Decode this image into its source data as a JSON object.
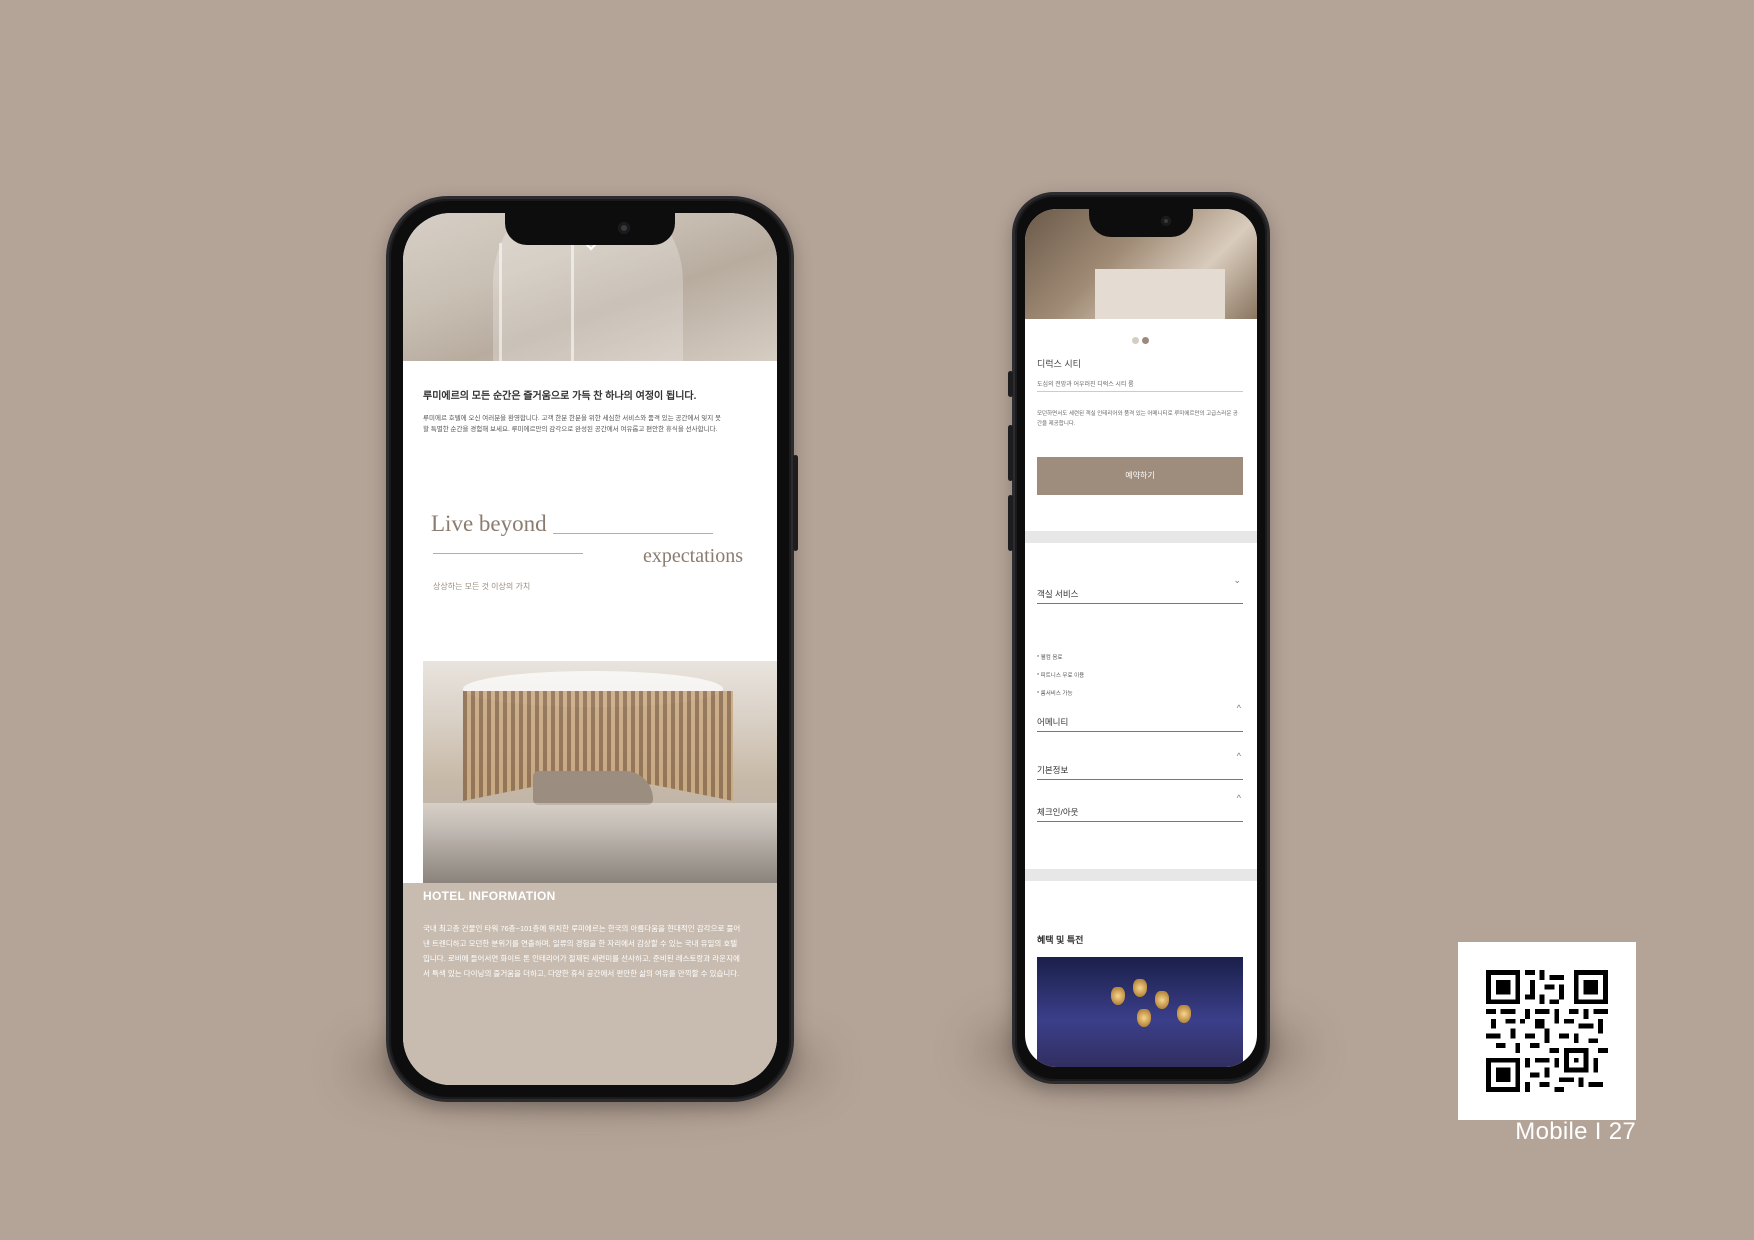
{
  "left_phone": {
    "intro": {
      "title": "루미에르의 모든 순간은 즐거움으로 가득 찬 하나의 여정이 됩니다.",
      "body": "루미에르 호텔에 오신 여러분을 환영합니다. 고객 한분 한분을 위한 세심한 서비스와 품격 있는 공간에서 잊지 못할 특별한 순간을 경험해 보세요. 루미에르만의 감각으로 완성된 공간에서 여유롭고 편안한 휴식을 선사합니다."
    },
    "slogan": {
      "line1": "Live beyond",
      "line2": "expectations",
      "sub": "상상하는 모든 것 이상의 가치"
    },
    "info": {
      "title": "HOTEL INFORMATION",
      "body": "국내 최고층 건물인 타워 76층~101층에 위치한 루미에르는 한국의 아름다움을 현대적인 감각으로 풀어낸 트렌디하고 모던한 분위기를 연출하며, 일류의 경험을 한 자리에서 감상할 수 있는 국내 유일의 호텔입니다. 로비에 들어서면 화이트 톤 인테리어가 절제된 세련미를 선사하고, 준비된 레스토랑과 라운지에서 특색 있는 다이닝의 즐거움을 더하고, 다양한 휴식 공간에서 편안한 삶의 여유를 만끽할 수 있습니다."
    }
  },
  "right_phone": {
    "room": {
      "title": "디럭스 시티",
      "sub": "도심의 전망과 어우러진 디럭스 시티 룸",
      "desc": "모던하면서도 세련된 객실 인테리어와 품격 있는 어메니티로 루미에르만의 고급스러운 공간을 제공합니다.",
      "button": "예약하기"
    },
    "accordion": [
      {
        "label": "객실 서비스",
        "chevron": "⌄"
      },
      {
        "label": "어메니티",
        "chevron": "^"
      },
      {
        "label": "기본정보",
        "chevron": "^"
      },
      {
        "label": "체크인/아웃",
        "chevron": "^"
      }
    ],
    "service_items": [
      "* 웰컴 음료",
      "* 피트니스 무료 이용",
      "* 룸서비스 가능"
    ],
    "benefits_title": "혜택 및 특전"
  },
  "caption": "Mobile I 27"
}
